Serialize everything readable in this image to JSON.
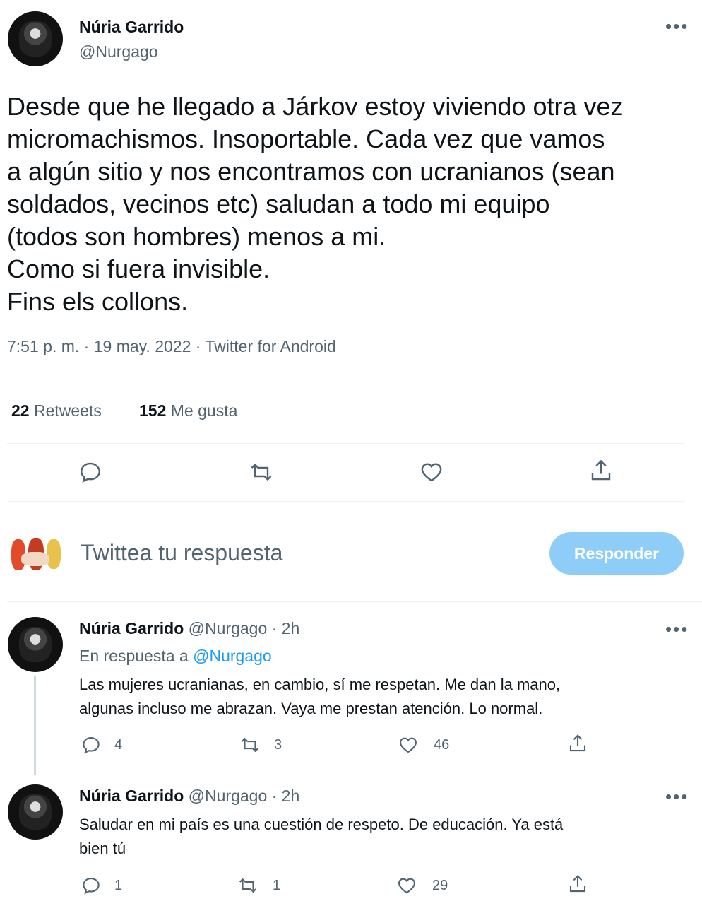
{
  "tweet": {
    "author_name": "Núria Garrido",
    "author_handle": "@Nurgago",
    "text_lines": [
      "Desde que he llegado a Járkov estoy viviendo otra vez",
      "micromachismos. Insoportable. Cada vez que vamos",
      "a algún sitio y nos encontramos con ucranianos (sean",
      "soldados, vecinos etc) saludan a todo mi equipo",
      "(todos son hombres) menos a mi.",
      "Como si fuera invisible.",
      "Fins els collons."
    ],
    "meta": "7:51 p. m. · 19 may. 2022 · Twitter for Android",
    "retweets_count": "22",
    "retweets_label": "Retweets",
    "likes_count": "152",
    "likes_label": "Me gusta"
  },
  "compose": {
    "placeholder": "Twittea tu respuesta",
    "button_label": "Responder"
  },
  "replies": [
    {
      "author_name": "Núria Garrido",
      "author_handle": "@Nurgago",
      "time": "· 2h",
      "reply_to_prefix": "En respuesta a",
      "reply_to_handle": "@Nurgago",
      "text_lines": [
        "Las mujeres ucranianas, en cambio, sí me respetan. Me dan la mano,",
        "algunas incluso me abrazan. Vaya me prestan atención. Lo normal."
      ],
      "reply_count": "4",
      "retweet_count": "3",
      "like_count": "46"
    },
    {
      "author_name": "Núria Garrido",
      "author_handle": "@Nurgago",
      "time": "· 2h",
      "text_lines": [
        "Saludar en mi país es una cuestión de respeto. De educación. Ya está",
        "bien tú"
      ],
      "reply_count": "1",
      "retweet_count": "1",
      "like_count": "29"
    }
  ],
  "colors": {
    "link": "#1d9bf0",
    "muted": "#536471",
    "button_disabled": "#8ecdf8",
    "divider": "#eff3f4"
  },
  "icons": [
    "more-icon",
    "reply-icon",
    "retweet-icon",
    "like-icon",
    "share-icon"
  ]
}
